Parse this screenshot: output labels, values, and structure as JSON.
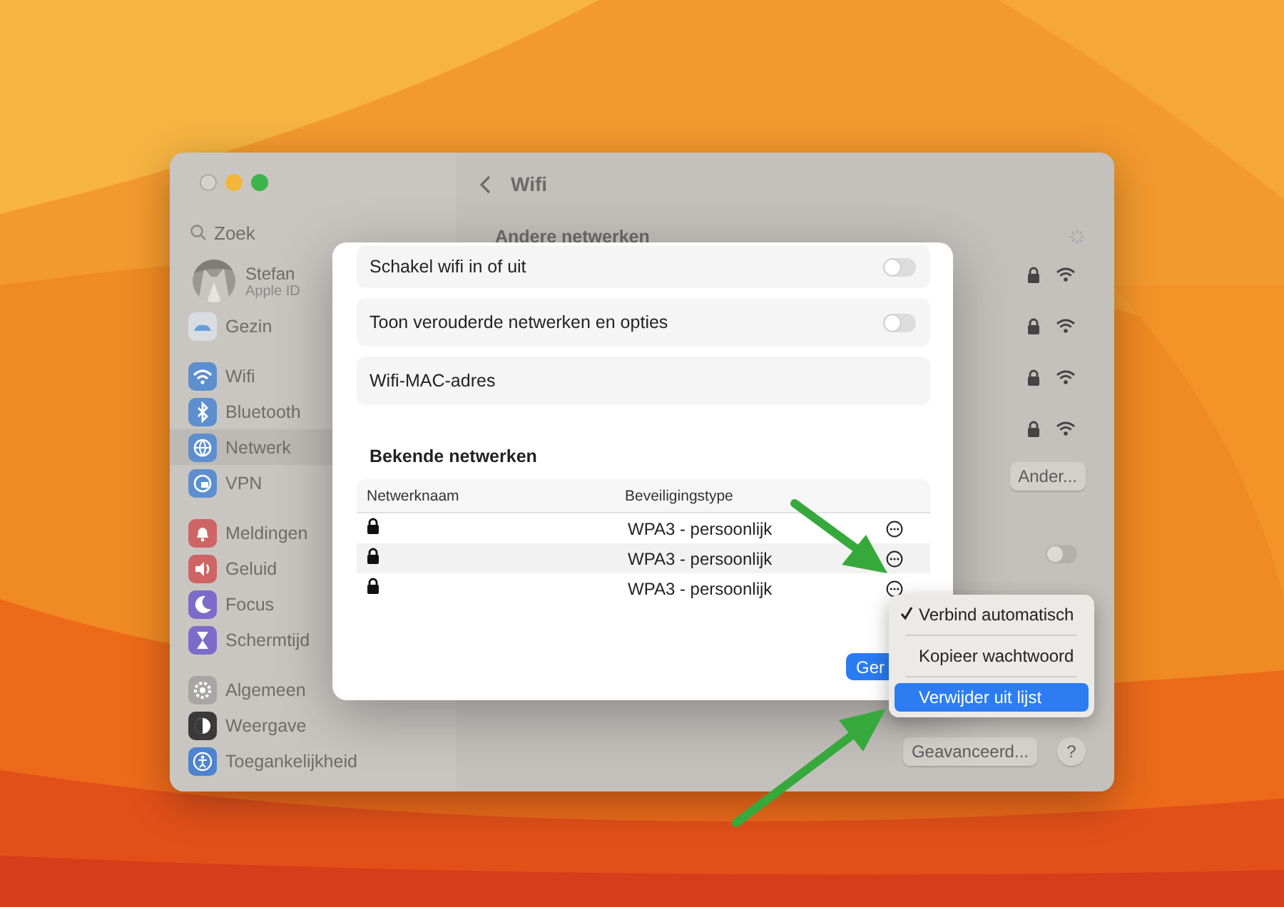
{
  "window": {
    "title": "Wifi"
  },
  "sidebar": {
    "search": {
      "placeholder": "Zoek"
    },
    "profile": {
      "name": "Stefan",
      "subtitle": "Apple ID"
    },
    "groups": [
      [
        {
          "kind": "family",
          "label": "Gezin",
          "selected": false
        }
      ],
      [
        {
          "kind": "wifi",
          "label": "Wifi",
          "selected": false
        },
        {
          "kind": "bluetooth",
          "label": "Bluetooth",
          "selected": false
        },
        {
          "kind": "network",
          "label": "Netwerk",
          "selected": true
        },
        {
          "kind": "vpn",
          "label": "VPN",
          "selected": false
        }
      ],
      [
        {
          "kind": "bell",
          "label": "Meldingen",
          "selected": false
        },
        {
          "kind": "sound",
          "label": "Geluid",
          "selected": false
        },
        {
          "kind": "moon",
          "label": "Focus",
          "selected": false
        },
        {
          "kind": "hourglass",
          "label": "Schermtijd",
          "selected": false
        }
      ],
      [
        {
          "kind": "gear",
          "label": "Algemeen",
          "selected": false
        },
        {
          "kind": "appearance",
          "label": "Weergave",
          "selected": false
        },
        {
          "kind": "accessibility",
          "label": "Toegankelijkheid",
          "selected": false
        }
      ]
    ]
  },
  "main": {
    "section_title": "Andere netwerken",
    "networks": [
      {
        "locked": true
      },
      {
        "locked": true
      },
      {
        "locked": true
      },
      {
        "locked": true
      }
    ],
    "other_button": "Ander...",
    "toggle": {
      "on": false
    },
    "advanced_button": "Geavanceerd...",
    "help_button": "?"
  },
  "sheet": {
    "toggles": [
      {
        "label": "Schakel wifi in of uit",
        "on": false
      },
      {
        "label": "Toon verouderde netwerken en opties",
        "on": false
      }
    ],
    "mac_row": "Wifi-MAC-adres",
    "known_title": "Bekende netwerken",
    "table": {
      "columns": [
        "Netwerknaam",
        "Beveiligingstype"
      ],
      "rows": [
        {
          "locked": true,
          "security": "WPA3 - persoonlijk"
        },
        {
          "locked": true,
          "security": "WPA3 - persoonlijk"
        },
        {
          "locked": true,
          "security": "WPA3 - persoonlijk"
        }
      ]
    },
    "primary_button": "Ger"
  },
  "menu": {
    "items": [
      {
        "label": "Verbind automatisch",
        "checked": true,
        "selected": false
      },
      {
        "label": "Kopieer wachtwoord",
        "checked": false,
        "selected": false
      },
      {
        "label": "Verwijder uit lijst",
        "checked": false,
        "selected": true
      }
    ]
  }
}
